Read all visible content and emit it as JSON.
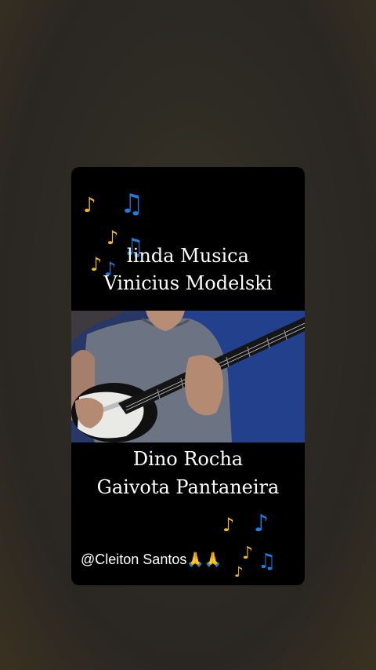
{
  "story": {
    "title_line1": "linda Musica",
    "title_line2": "Vinicius Modelski",
    "subtitle_line1": "Dino Rocha",
    "subtitle_line2": "Gaivota Pantaneira",
    "credit": "@Cleiton Santos",
    "credit_emojis": "🙏🙏"
  },
  "colors": {
    "card_background": "#000000",
    "note_gold": "#f2b820",
    "note_blue": "#1f7fe0",
    "page_background": "#2c2a25"
  },
  "icons": {
    "note_single": "♪",
    "note_double": "♫"
  }
}
